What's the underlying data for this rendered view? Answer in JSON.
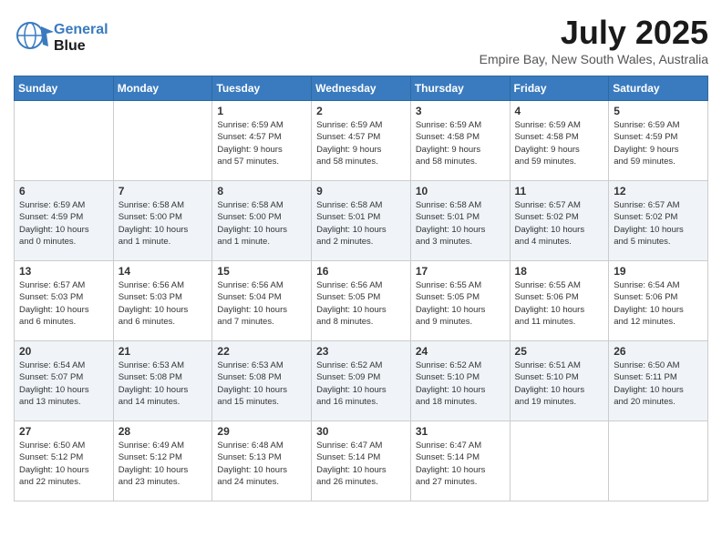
{
  "logo": {
    "line1": "General",
    "line2": "Blue"
  },
  "title": "July 2025",
  "location": "Empire Bay, New South Wales, Australia",
  "days_header": [
    "Sunday",
    "Monday",
    "Tuesday",
    "Wednesday",
    "Thursday",
    "Friday",
    "Saturday"
  ],
  "weeks": [
    [
      {
        "num": "",
        "info": ""
      },
      {
        "num": "",
        "info": ""
      },
      {
        "num": "1",
        "info": "Sunrise: 6:59 AM\nSunset: 4:57 PM\nDaylight: 9 hours\nand 57 minutes."
      },
      {
        "num": "2",
        "info": "Sunrise: 6:59 AM\nSunset: 4:57 PM\nDaylight: 9 hours\nand 58 minutes."
      },
      {
        "num": "3",
        "info": "Sunrise: 6:59 AM\nSunset: 4:58 PM\nDaylight: 9 hours\nand 58 minutes."
      },
      {
        "num": "4",
        "info": "Sunrise: 6:59 AM\nSunset: 4:58 PM\nDaylight: 9 hours\nand 59 minutes."
      },
      {
        "num": "5",
        "info": "Sunrise: 6:59 AM\nSunset: 4:59 PM\nDaylight: 9 hours\nand 59 minutes."
      }
    ],
    [
      {
        "num": "6",
        "info": "Sunrise: 6:59 AM\nSunset: 4:59 PM\nDaylight: 10 hours\nand 0 minutes."
      },
      {
        "num": "7",
        "info": "Sunrise: 6:58 AM\nSunset: 5:00 PM\nDaylight: 10 hours\nand 1 minute."
      },
      {
        "num": "8",
        "info": "Sunrise: 6:58 AM\nSunset: 5:00 PM\nDaylight: 10 hours\nand 1 minute."
      },
      {
        "num": "9",
        "info": "Sunrise: 6:58 AM\nSunset: 5:01 PM\nDaylight: 10 hours\nand 2 minutes."
      },
      {
        "num": "10",
        "info": "Sunrise: 6:58 AM\nSunset: 5:01 PM\nDaylight: 10 hours\nand 3 minutes."
      },
      {
        "num": "11",
        "info": "Sunrise: 6:57 AM\nSunset: 5:02 PM\nDaylight: 10 hours\nand 4 minutes."
      },
      {
        "num": "12",
        "info": "Sunrise: 6:57 AM\nSunset: 5:02 PM\nDaylight: 10 hours\nand 5 minutes."
      }
    ],
    [
      {
        "num": "13",
        "info": "Sunrise: 6:57 AM\nSunset: 5:03 PM\nDaylight: 10 hours\nand 6 minutes."
      },
      {
        "num": "14",
        "info": "Sunrise: 6:56 AM\nSunset: 5:03 PM\nDaylight: 10 hours\nand 6 minutes."
      },
      {
        "num": "15",
        "info": "Sunrise: 6:56 AM\nSunset: 5:04 PM\nDaylight: 10 hours\nand 7 minutes."
      },
      {
        "num": "16",
        "info": "Sunrise: 6:56 AM\nSunset: 5:05 PM\nDaylight: 10 hours\nand 8 minutes."
      },
      {
        "num": "17",
        "info": "Sunrise: 6:55 AM\nSunset: 5:05 PM\nDaylight: 10 hours\nand 9 minutes."
      },
      {
        "num": "18",
        "info": "Sunrise: 6:55 AM\nSunset: 5:06 PM\nDaylight: 10 hours\nand 11 minutes."
      },
      {
        "num": "19",
        "info": "Sunrise: 6:54 AM\nSunset: 5:06 PM\nDaylight: 10 hours\nand 12 minutes."
      }
    ],
    [
      {
        "num": "20",
        "info": "Sunrise: 6:54 AM\nSunset: 5:07 PM\nDaylight: 10 hours\nand 13 minutes."
      },
      {
        "num": "21",
        "info": "Sunrise: 6:53 AM\nSunset: 5:08 PM\nDaylight: 10 hours\nand 14 minutes."
      },
      {
        "num": "22",
        "info": "Sunrise: 6:53 AM\nSunset: 5:08 PM\nDaylight: 10 hours\nand 15 minutes."
      },
      {
        "num": "23",
        "info": "Sunrise: 6:52 AM\nSunset: 5:09 PM\nDaylight: 10 hours\nand 16 minutes."
      },
      {
        "num": "24",
        "info": "Sunrise: 6:52 AM\nSunset: 5:10 PM\nDaylight: 10 hours\nand 18 minutes."
      },
      {
        "num": "25",
        "info": "Sunrise: 6:51 AM\nSunset: 5:10 PM\nDaylight: 10 hours\nand 19 minutes."
      },
      {
        "num": "26",
        "info": "Sunrise: 6:50 AM\nSunset: 5:11 PM\nDaylight: 10 hours\nand 20 minutes."
      }
    ],
    [
      {
        "num": "27",
        "info": "Sunrise: 6:50 AM\nSunset: 5:12 PM\nDaylight: 10 hours\nand 22 minutes."
      },
      {
        "num": "28",
        "info": "Sunrise: 6:49 AM\nSunset: 5:12 PM\nDaylight: 10 hours\nand 23 minutes."
      },
      {
        "num": "29",
        "info": "Sunrise: 6:48 AM\nSunset: 5:13 PM\nDaylight: 10 hours\nand 24 minutes."
      },
      {
        "num": "30",
        "info": "Sunrise: 6:47 AM\nSunset: 5:14 PM\nDaylight: 10 hours\nand 26 minutes."
      },
      {
        "num": "31",
        "info": "Sunrise: 6:47 AM\nSunset: 5:14 PM\nDaylight: 10 hours\nand 27 minutes."
      },
      {
        "num": "",
        "info": ""
      },
      {
        "num": "",
        "info": ""
      }
    ]
  ]
}
